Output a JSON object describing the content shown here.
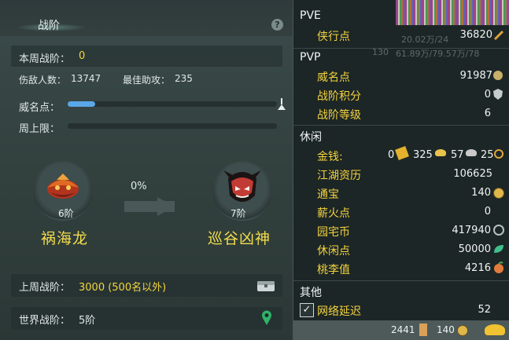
{
  "left": {
    "title": "战阶",
    "help": "?",
    "weekly_label": "本周战阶：",
    "weekly_value": "0",
    "kills_label": "伤敌人数：",
    "kills_value": "13747",
    "assist_label": "最佳助攻：",
    "assist_value": "235",
    "fame_label": "威名点：",
    "fame_progress": 0.13,
    "weekly_cap_label": "周上限：",
    "weekly_cap_progress": 0,
    "progress_pct": "0%",
    "current_rank": "6阶",
    "current_name": "祸海龙",
    "next_rank": "7阶",
    "next_name": "巡谷凶神",
    "last_week_label": "上周战阶：",
    "last_week_value": "3000 (500名以外)",
    "world_label": "世界战阶：",
    "world_value": "5阶"
  },
  "right": {
    "pve": {
      "title": "PVE",
      "items": [
        {
          "label": "侠行点",
          "value": "36820"
        }
      ]
    },
    "pvp": {
      "title": "PVP",
      "items": [
        {
          "label": "威名点",
          "value": "91987"
        },
        {
          "label": "战阶积分",
          "value": "0"
        },
        {
          "label": "战阶等级",
          "value": "6"
        }
      ]
    },
    "leisure": {
      "title": "休闲",
      "money_label": "金钱:",
      "money": {
        "a": "0",
        "b": "325",
        "c": "57",
        "d": "25"
      },
      "items": [
        {
          "label": "江湖资历",
          "value": "106625"
        },
        {
          "label": "通宝",
          "value": "140"
        },
        {
          "label": "薪火点",
          "value": "0"
        },
        {
          "label": "园宅币",
          "value": "417940"
        },
        {
          "label": "休闲点",
          "value": "50000"
        },
        {
          "label": "桃李值",
          "value": "4216"
        }
      ]
    },
    "other": {
      "title": "其他",
      "checkbox_mark": "✓",
      "latency_label": "网络延迟",
      "latency_value": "52"
    },
    "bottom": {
      "left_value": "2441",
      "right_value": "140"
    },
    "background_text": [
      "20.02万/24",
      "130",
      "61.89万/79.57万/78"
    ]
  },
  "colors": {
    "gold": "#f2d541",
    "progress_blue": "#5aa7e8",
    "panel": "#1c2626"
  }
}
